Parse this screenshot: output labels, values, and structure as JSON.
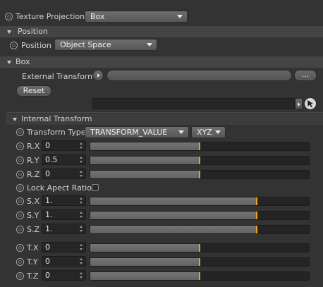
{
  "texture_projection": {
    "label": "Texture Projection",
    "value": "Box"
  },
  "position_group": {
    "header": "Position",
    "position": {
      "label": "Position",
      "value": "Object Space"
    }
  },
  "box_group": {
    "header": "Box",
    "external_transform": {
      "label": "External Transform",
      "browse_label": "...",
      "value": ""
    },
    "reset_label": "Reset"
  },
  "internal_transform": {
    "header": "Internal Transform",
    "transform_type": {
      "label": "Transform Type",
      "value": "TRANSFORM_VALUE",
      "order": "XYZ"
    },
    "rotation": [
      {
        "label": "R.X",
        "value": "0",
        "level": 0.5
      },
      {
        "label": "R.Y",
        "value": "0.5",
        "level": 0.5
      },
      {
        "label": "R.Z",
        "value": "0",
        "level": 0.5
      }
    ],
    "lock_aspect": {
      "label": "Lock Apect Ratio",
      "checked": false
    },
    "scale": [
      {
        "label": "S.X",
        "value": "1.",
        "level": 0.76
      },
      {
        "label": "S.Y",
        "value": "1.",
        "level": 0.76
      },
      {
        "label": "S.Z",
        "value": "1.",
        "level": 0.76
      }
    ],
    "translation": [
      {
        "label": "T.X",
        "value": "0",
        "level": 0.5
      },
      {
        "label": "T.Y",
        "value": "0",
        "level": 0.5
      },
      {
        "label": "T.Z",
        "value": "0",
        "level": 0.5
      }
    ]
  },
  "colors": {
    "marker": "#f0a020",
    "background": "#333333",
    "header": "#444444"
  }
}
